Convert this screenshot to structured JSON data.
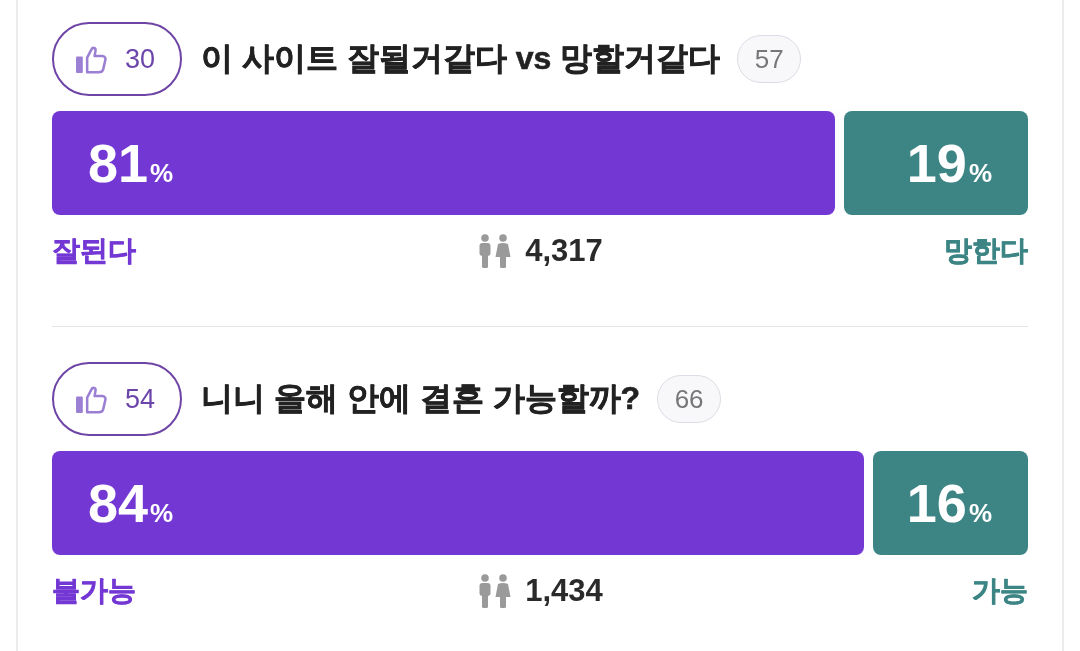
{
  "polls": [
    {
      "likes": "30",
      "title": "이 사이트 잘될거같다 vs 망할거같다",
      "comments": "57",
      "options": [
        {
          "label": "잘된다",
          "value": "81",
          "unit": "%",
          "level": 0.81,
          "color": "#7338d4"
        },
        {
          "label": "망한다",
          "value": "19",
          "unit": "%",
          "level": 0.19,
          "color": "#3d8585"
        }
      ],
      "voters": "4,317"
    },
    {
      "likes": "54",
      "title": "니니 올해 안에 결혼 가능할까?",
      "comments": "66",
      "options": [
        {
          "label": "불가능",
          "value": "84",
          "unit": "%",
          "level": 0.84,
          "color": "#7338d4"
        },
        {
          "label": "가능",
          "value": "16",
          "unit": "%",
          "level": 0.16,
          "color": "#3d8585"
        }
      ],
      "voters": "1,434"
    }
  ]
}
